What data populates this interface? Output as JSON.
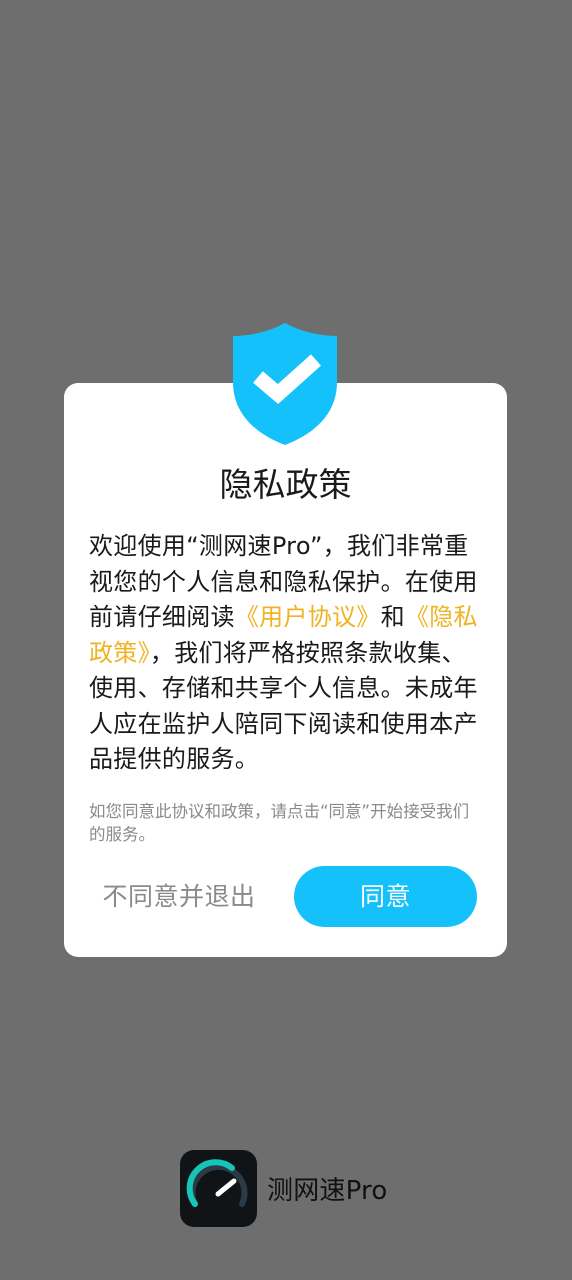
{
  "dialog": {
    "title": "隐私政策",
    "body_intro": "欢迎使用“测网速Pro”，我们非常重视您的个人信息和隐私保护。在使用前请仔细阅读",
    "user_agreement_link": "《用户协议》",
    "and_text": "和",
    "privacy_policy_link": "《隐私政策》",
    "body_outro": "，我们将严格按照条款收集、使用、存储和共享个人信息。未成年人应在监护人陪同下阅读和使用本产品提供的服务。",
    "note": "如您同意此协议和政策，请点击“同意”开始接受我们的服务。",
    "decline_label": "不同意并退出",
    "agree_label": "同意"
  },
  "brand": {
    "app_name": "测网速Pro",
    "icon": "speedometer-icon"
  },
  "icons": {
    "shield": "shield-check-icon"
  },
  "colors": {
    "overlay": "#6e6e6e",
    "accent": "#14c1fb",
    "link": "#f0b323",
    "muted": "#8a8a8a"
  }
}
